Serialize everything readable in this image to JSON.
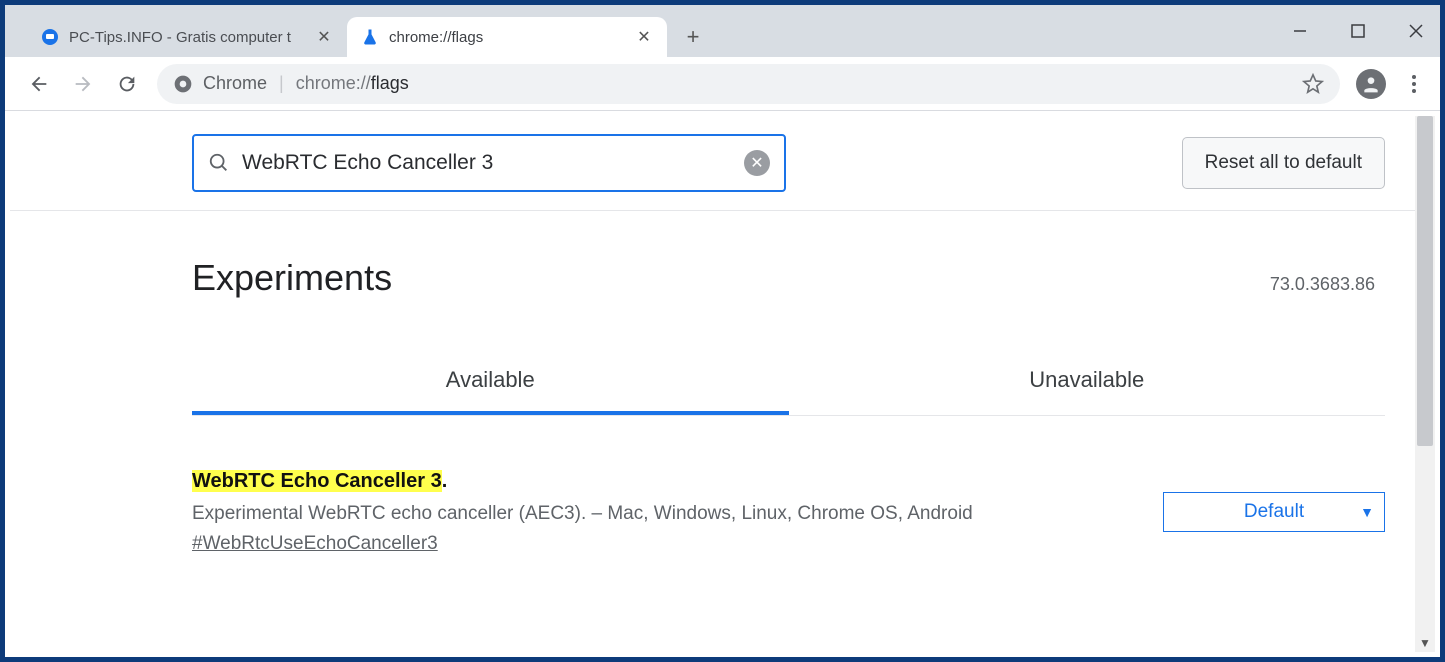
{
  "window": {
    "tabs": [
      {
        "title": "PC-Tips.INFO - Gratis computer t",
        "active": false
      },
      {
        "title": "chrome://flags",
        "active": true
      }
    ]
  },
  "omnibox": {
    "label": "Chrome",
    "url_prefix": "chrome://",
    "url_path": "flags"
  },
  "page": {
    "search_value": "WebRTC Echo Canceller 3",
    "reset_label": "Reset all to default",
    "heading": "Experiments",
    "version": "73.0.3683.86",
    "tabs": {
      "available": "Available",
      "unavailable": "Unavailable"
    },
    "flag": {
      "title_highlight": "WebRTC Echo Canceller 3",
      "title_suffix": ".",
      "description": "Experimental WebRTC echo canceller (AEC3). – Mac, Windows, Linux, Chrome OS, Android",
      "anchor": "#WebRtcUseEchoCanceller3",
      "dropdown_value": "Default"
    }
  }
}
